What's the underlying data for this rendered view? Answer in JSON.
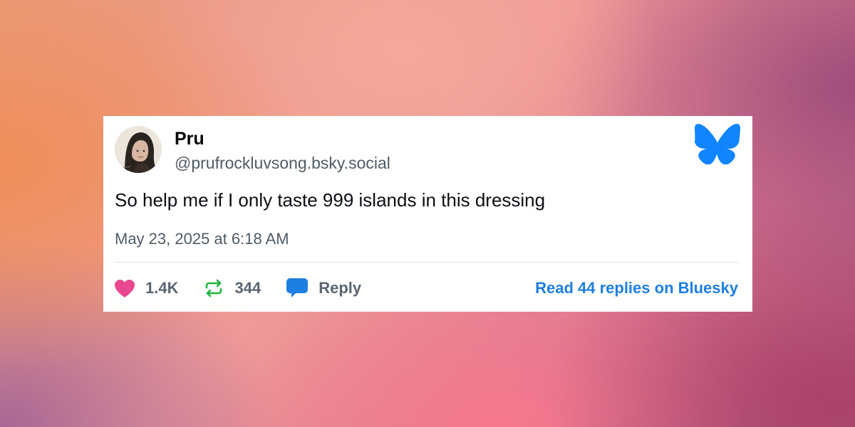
{
  "post": {
    "author_name": "Pru",
    "author_handle": "@prufrockluvsong.bsky.social",
    "text": "So help me if I only taste 999 islands in this dressing",
    "timestamp": "May 23, 2025 at 6:18 AM"
  },
  "actions": {
    "like_count": "1.4K",
    "repost_count": "344",
    "reply_label": "Reply",
    "read_replies_label": "Read 44 replies on Bluesky"
  },
  "icons": {
    "like": "heart-icon",
    "repost": "repost-icon",
    "reply": "speech-bubble-icon",
    "brand": "bluesky-butterfly-icon"
  },
  "colors": {
    "like": "#e8488f",
    "repost": "#20b43c",
    "reply": "#1d7fe0",
    "brand": "#1185fe",
    "link": "#1d7fe0"
  }
}
